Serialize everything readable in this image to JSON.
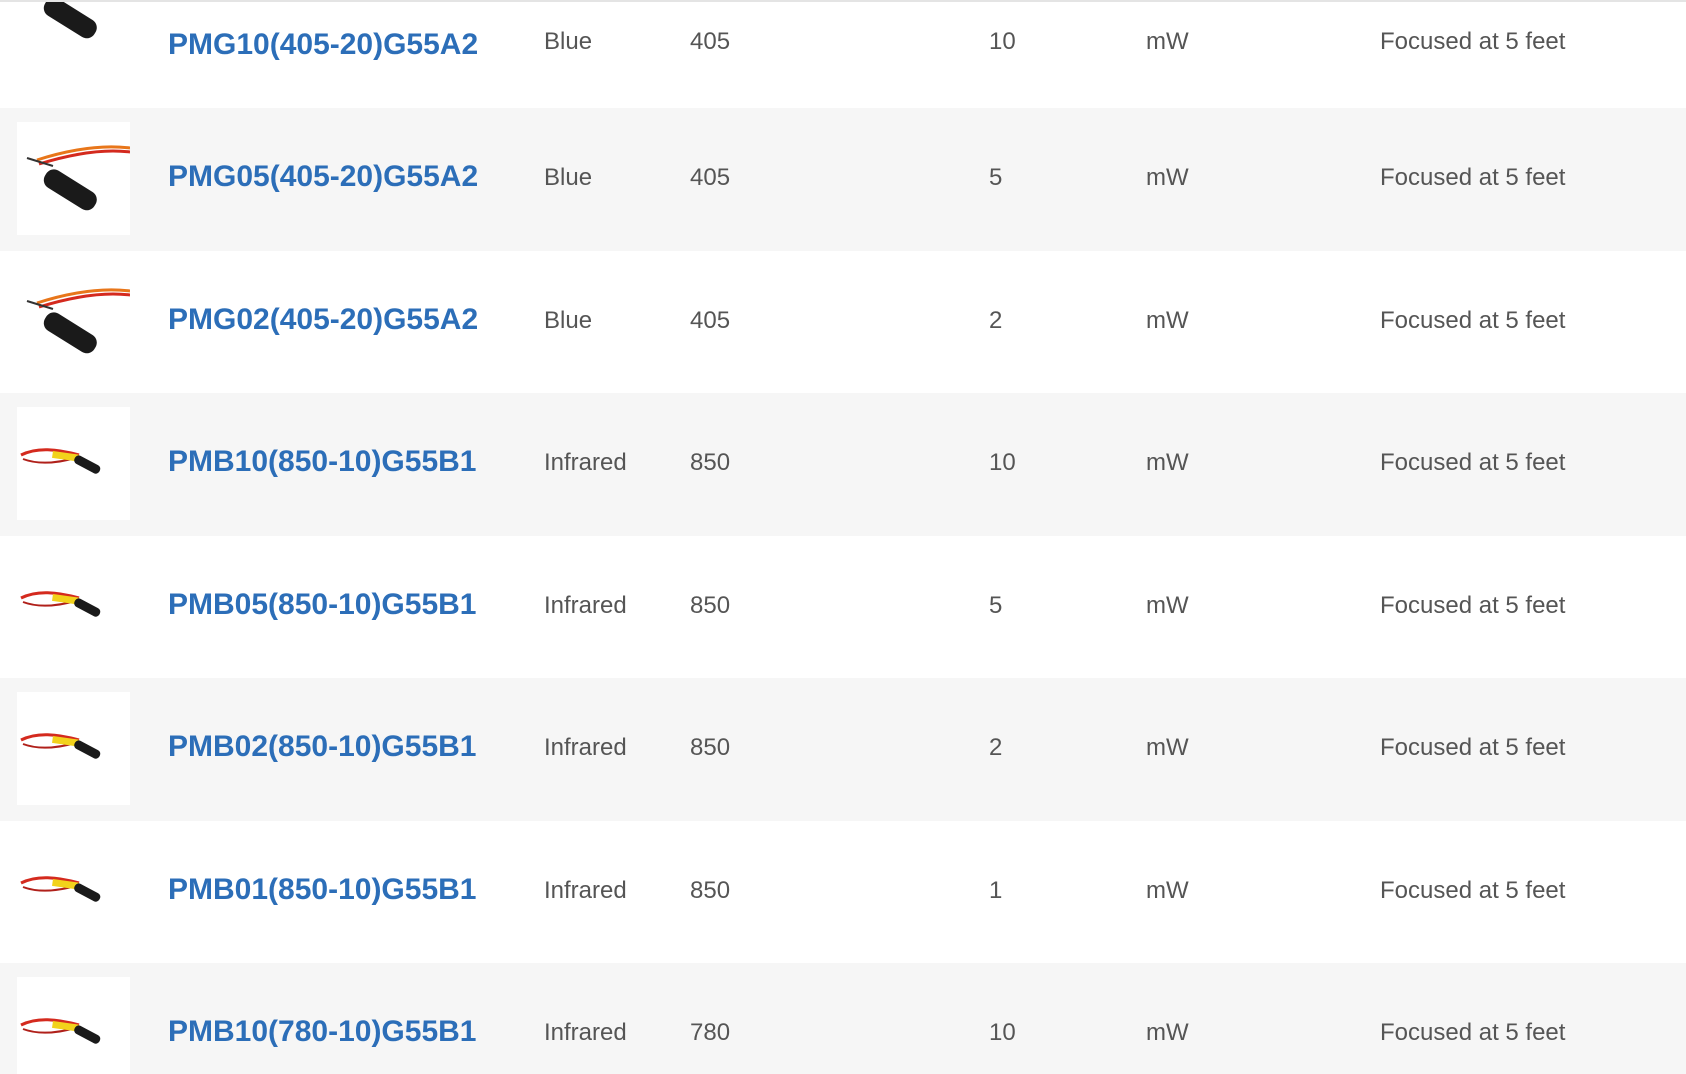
{
  "products": [
    {
      "part": "PMG10(405-20)G55A2",
      "color": "Blue",
      "wavelength": "405",
      "power": "10",
      "unit": "mW",
      "focus": "Focused at 5 feet",
      "thumbnail": "blue-laser-module-icon"
    },
    {
      "part": "PMG05(405-20)G55A2",
      "color": "Blue",
      "wavelength": "405",
      "power": "5",
      "unit": "mW",
      "focus": "Focused at 5 feet",
      "thumbnail": "blue-laser-module-icon"
    },
    {
      "part": "PMG02(405-20)G55A2",
      "color": "Blue",
      "wavelength": "405",
      "power": "2",
      "unit": "mW",
      "focus": "Focused at 5 feet",
      "thumbnail": "blue-laser-module-icon"
    },
    {
      "part": "PMB10(850-10)G55B1",
      "color": "Infrared",
      "wavelength": "850",
      "power": "10",
      "unit": "mW",
      "focus": "Focused at 5 feet",
      "thumbnail": "infrared-laser-module-icon"
    },
    {
      "part": "PMB05(850-10)G55B1",
      "color": "Infrared",
      "wavelength": "850",
      "power": "5",
      "unit": "mW",
      "focus": "Focused at 5 feet",
      "thumbnail": "infrared-laser-module-icon"
    },
    {
      "part": "PMB02(850-10)G55B1",
      "color": "Infrared",
      "wavelength": "850",
      "power": "2",
      "unit": "mW",
      "focus": "Focused at 5 feet",
      "thumbnail": "infrared-laser-module-icon"
    },
    {
      "part": "PMB01(850-10)G55B1",
      "color": "Infrared",
      "wavelength": "850",
      "power": "1",
      "unit": "mW",
      "focus": "Focused at 5 feet",
      "thumbnail": "infrared-laser-module-icon"
    },
    {
      "part": "PMB10(780-10)G55B1",
      "color": "Infrared",
      "wavelength": "780",
      "power": "10",
      "unit": "mW",
      "focus": "Focused at 5 feet",
      "thumbnail": "infrared-laser-module-icon"
    }
  ],
  "colors": {
    "link": "#2c6eb8",
    "text": "#555555",
    "row_alt": "#f6f6f6",
    "wire_red": "#d42a1e",
    "wire_orange": "#e8761a",
    "body_dark": "#1a1a1a",
    "board_yellow": "#f2d21b"
  }
}
